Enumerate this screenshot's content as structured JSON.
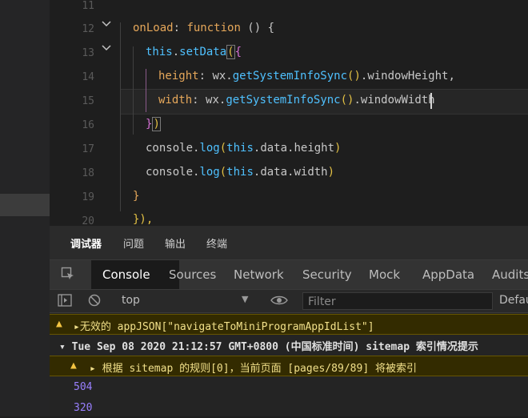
{
  "editor": {
    "line_numbers": [
      "11",
      "12",
      "13",
      "14",
      "15",
      "16",
      "17",
      "18",
      "19",
      "20"
    ],
    "lines": {
      "l12": {
        "key": "onLoad",
        "colon": ": ",
        "kw": "function",
        "rest": " () {"
      },
      "l13": {
        "this": "this",
        "dot": ".",
        "fn": "setData",
        "open": "(",
        "brace": "{"
      },
      "l14": {
        "key": "height",
        "colon": ": ",
        "obj": "wx.",
        "fn": "getSystemInfoSync",
        "call": "()",
        "prop": ".windowHeight,"
      },
      "l15": {
        "key": "width",
        "colon": ": ",
        "obj": "wx.",
        "fn": "getSystemInfoSync",
        "call": "()",
        "prop": ".windowWidth"
      },
      "l16": {
        "brace": "}",
        "close": ")"
      },
      "l17": {
        "obj": "console.",
        "fn": "log",
        "open": "(",
        "this": "this",
        "prop": ".data.height",
        "close": ")"
      },
      "l18": {
        "obj": "console.",
        "fn": "log",
        "open": "(",
        "this": "this",
        "prop": ".data.width",
        "close": ")"
      },
      "l19": {
        "text": "}"
      },
      "l20": {
        "text": "}),"
      }
    }
  },
  "devtools": {
    "top_tabs": [
      "调试器",
      "问题",
      "输出",
      "终端"
    ],
    "panel_tabs": [
      "Console",
      "Sources",
      "Network",
      "Security",
      "Mock",
      "AppData",
      "Audits"
    ],
    "toolbar": {
      "context": "top",
      "filter_placeholder": "Filter",
      "levels": "Defau"
    },
    "messages": {
      "warn1": "▸无效的 appJSON[\"navigateToMiniProgramAppIdList\"]",
      "group": "▾ Tue Sep 08 2020 21:12:57 GMT+0800 (中国标准时间) sitemap 索引情况提示",
      "warn2": "▸ 根据 sitemap 的规则[0]，当前页面 [pages/89/89] 将被索引",
      "log1": "504",
      "log2": "320"
    }
  },
  "colors": {
    "accent": "#4a90e2",
    "warning_bg": "#332b00",
    "warning_text": "#f1e08a",
    "number": "#9980ff"
  }
}
